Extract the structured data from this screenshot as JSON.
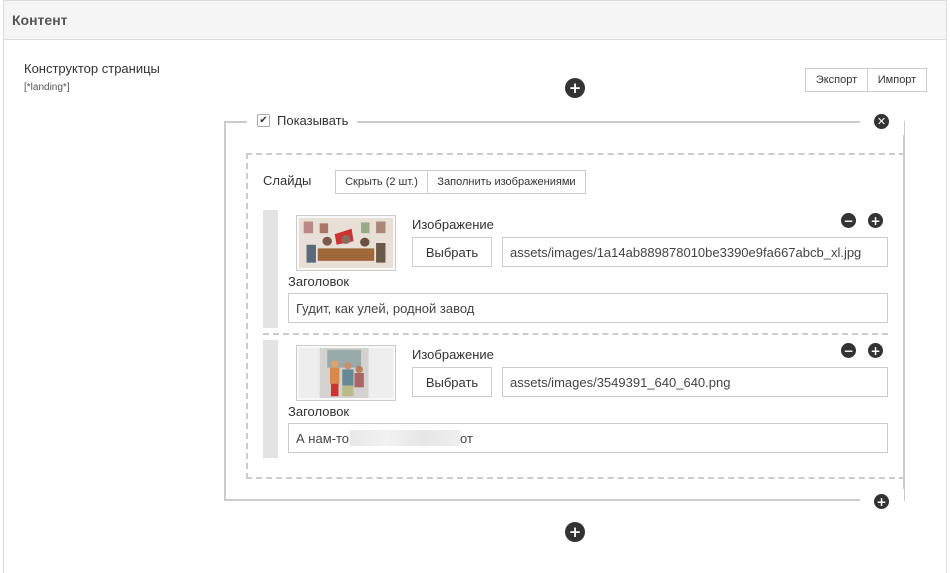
{
  "panel": {
    "title": "Контент"
  },
  "field": {
    "label": "Конструктор страницы",
    "sub": "[*landing*]"
  },
  "toolbar": {
    "export_label": "Экспорт",
    "import_label": "Импорт"
  },
  "block": {
    "show_label": "Показывать",
    "show_checked": true
  },
  "slides": {
    "label": "Слайды",
    "hide_label": "Скрыть (2 шт.)",
    "fill_label": "Заполнить изображениями",
    "items": [
      {
        "image_label": "Изображение",
        "choose_label": "Выбрать",
        "image_path": "assets/images/1a14ab889878010be3390e9fa667abcb_xl.jpg",
        "title_label": "Заголовок",
        "title_value": "Гудит, как улей, родной завод"
      },
      {
        "image_label": "Изображение",
        "choose_label": "Выбрать",
        "image_path": "assets/images/3549391_640_640.png",
        "title_label": "Заголовок",
        "title_value_start": "А нам-то",
        "title_value_end": "от"
      }
    ]
  },
  "icons": {
    "add": "plus-circle-icon",
    "remove": "minus-circle-icon",
    "close": "close-circle-icon",
    "check": "check-icon"
  }
}
